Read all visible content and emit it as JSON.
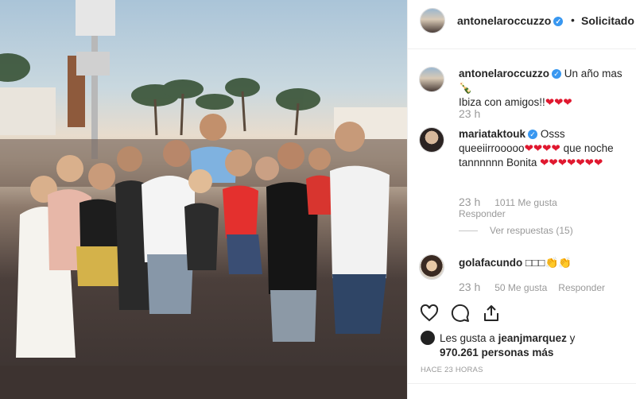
{
  "post": {
    "username": "antonelaroccuzzo",
    "follow_state": "Solicitado",
    "separator": "•",
    "verified_glyph": "✓"
  },
  "caption": {
    "username": "antonelaroccuzzo",
    "text": "Un año mas ",
    "text2": "Ibiza con amigos!!",
    "hearts": "❤❤❤",
    "emoji": "🍾",
    "time": "23 h"
  },
  "comments": [
    {
      "username": "mariataktouk",
      "text": "Osss queeiirrooooo",
      "hearts_a": "❤❤❤❤",
      "text2": " que noche tannnnnn Bonita ",
      "hearts_b": "❤❤❤❤❤❤❤",
      "time": "23 h",
      "likes": "1011 Me gusta",
      "reply": "Responder",
      "view_replies": "Ver respuestas (15)"
    },
    {
      "username": "golafacundo",
      "text": " □□□👏👏",
      "time": "23 h",
      "likes": "50 Me gusta",
      "reply": "Responder"
    }
  ],
  "likes": {
    "prefix": "Les gusta a ",
    "user": "jeanjmarquez",
    "join": " y",
    "count": "970.261 personas más"
  },
  "timestamp": "HACE 23 HORAS",
  "icons": [
    "heart-icon",
    "comment-icon",
    "share-icon",
    "verified-icon"
  ],
  "colors": {
    "verified": "#3897f0",
    "heart": "#e0182f",
    "muted": "#999999"
  }
}
